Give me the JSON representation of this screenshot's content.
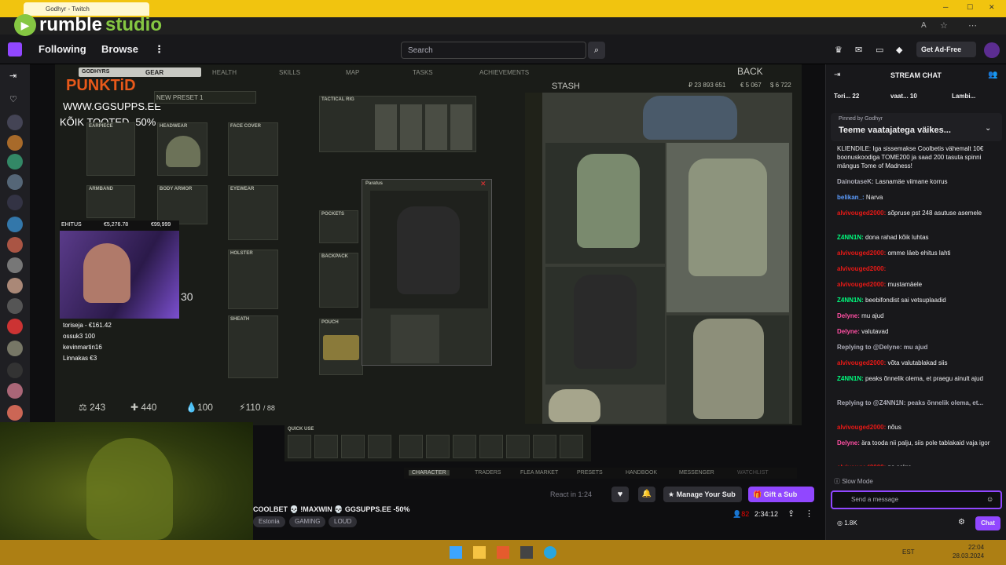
{
  "browser": {
    "tab_title": "Godhyr - Twitch",
    "watermark_brand": "rumble",
    "watermark_brand2": "studio"
  },
  "nav": {
    "following": "Following",
    "browse": "Browse",
    "search_placeholder": "Search",
    "get_ad_free": "Get Ad-Free"
  },
  "game": {
    "player": "GODHYRS",
    "tabs": [
      "GEAR",
      "HEALTH",
      "SKILLS",
      "MAP",
      "TASKS",
      "ACHIEVEMENTS"
    ],
    "back": "BACK",
    "preset": "NEW PRESET 1",
    "stash_label": "STASH",
    "stash_money": "₽ 23 893 651",
    "stash_eur": "€ 5 067",
    "stash_usd": "$ 6 722",
    "slots": {
      "earpiece": "EARPIECE",
      "headwear": "HEADWEAR",
      "face_cover": "FACE COVER",
      "armband": "ARMBAND",
      "body_armor": "BODY ARMOR",
      "eyewear": "EYEWEAR",
      "tactical_rig": "TACTICAL RIG",
      "pockets": "POCKETS",
      "backpack": "BACKPACK",
      "holster": "HOLSTER",
      "sheath": "SHEATH",
      "pouch": "POUCH",
      "quick_use": "QUICK USE"
    },
    "paratus": "Paratus",
    "sponsor_logo": "PUNKTiD",
    "sponsor_url": "WWW.GGSUPPS.EE",
    "sponsor_promo": "KÕIK TOOTED -50%",
    "eesmark_label": "EHITUS",
    "eesmark_current": "€5,276.78",
    "eesmark_goal": "€99,999",
    "donors": [
      "toriseja - €161.42",
      "ossuk3 100",
      "kevinmartin16",
      "Linnakas €3"
    ],
    "stats": {
      "weight": "243",
      "health": "440",
      "hydration": "100",
      "energy": "110"
    },
    "stat_max": "/ 88",
    "cam_number": "30",
    "bottom_tabs": [
      "CHARACTER",
      "TRADERS",
      "FLEA MARKET",
      "PRESETS",
      "HANDBOOK",
      "MESSENGER",
      "WATCHLIST"
    ]
  },
  "stream": {
    "title": "COOLBET 💀 !MAXWIN 💀 GGSUPPS.EE -50%",
    "tags": [
      "Estonia",
      "GAMING",
      "LOUD"
    ],
    "react": "React in 1:24",
    "manage_sub": "Manage Your Sub",
    "gift_sub": "Gift a Sub",
    "viewers": "82",
    "uptime": "2:34:12"
  },
  "chat": {
    "header": "STREAM CHAT",
    "leaders": [
      {
        "name": "Tori...",
        "value": "22"
      },
      {
        "name": "vaat...",
        "value": "10"
      },
      {
        "name": "Lambi...",
        "value": ""
      }
    ],
    "pinned_by": "Pinned by Godhyr",
    "pinned_text": "Teeme vaatajatega väikes...",
    "messages": [
      {
        "user": "",
        "text": "KLIENDILE: Iga sissemakse Coolbetis vähemalt 10€ boonuskoodiga TOME200 ja saad 200 tasuta spinni mängus Tome of Madness!",
        "color": "grey"
      },
      {
        "user": "DainotaseK:",
        "text": "Lasnamäe viimane korrus",
        "color": "grey"
      },
      {
        "user": "belikan_:",
        "text": "Narva",
        "color": "blue"
      },
      {
        "user": "alvivouged2000:",
        "text": "sõpruse pst 248 asutuse asemele",
        "color": "red"
      },
      {
        "user": "Z4NN1N:",
        "text": "dona rahad kõik luhtas",
        "color": "green"
      },
      {
        "user": "alvivouged2000:",
        "text": "omme läeb ehitus lahti",
        "color": "red"
      },
      {
        "user": "alvivouged2000:",
        "text": "",
        "color": "red"
      },
      {
        "user": "alvivouged2000:",
        "text": "mustamäele",
        "color": "red"
      },
      {
        "user": "Z4NN1N:",
        "text": "beebifondist sai vetsuplaadid",
        "color": "green"
      },
      {
        "user": "Delyne:",
        "text": "mu ajud",
        "color": "pink"
      },
      {
        "user": "Delyne:",
        "text": "valutavad",
        "color": "pink"
      },
      {
        "user": "Replying to @Delyne: mu ajud",
        "text": "",
        "color": "grey"
      },
      {
        "user": "alvivouged2000:",
        "text": "võta valutablakad siis",
        "color": "red"
      },
      {
        "user": "Z4NN1N:",
        "text": "peaks õnnelik olema, et praegu ainult ajud",
        "color": "green"
      },
      {
        "user": "Replying to @Z4NN1N: peaks õnnelik olema, et...",
        "text": "",
        "color": "grey"
      },
      {
        "user": "alvivouged2000:",
        "text": "nõus",
        "color": "red"
      },
      {
        "user": "Delyne:",
        "text": "ära tooda nii palju, siis pole tablakaid vaja igor",
        "color": "pink"
      },
      {
        "user": "alvivouged2000:",
        "text": "no selge",
        "color": "red"
      }
    ],
    "slow_mode": "Slow Mode",
    "send_placeholder": "Send a message",
    "points": "1.8K",
    "chat_button": "Chat"
  },
  "taskbar": {
    "lang": "EST",
    "time": "22:04",
    "date": "28.03.2024"
  },
  "colors": {
    "twitch_purple": "#9147ff",
    "browser_bar": "#f1c40f",
    "taskbar": "#ad7f14"
  }
}
